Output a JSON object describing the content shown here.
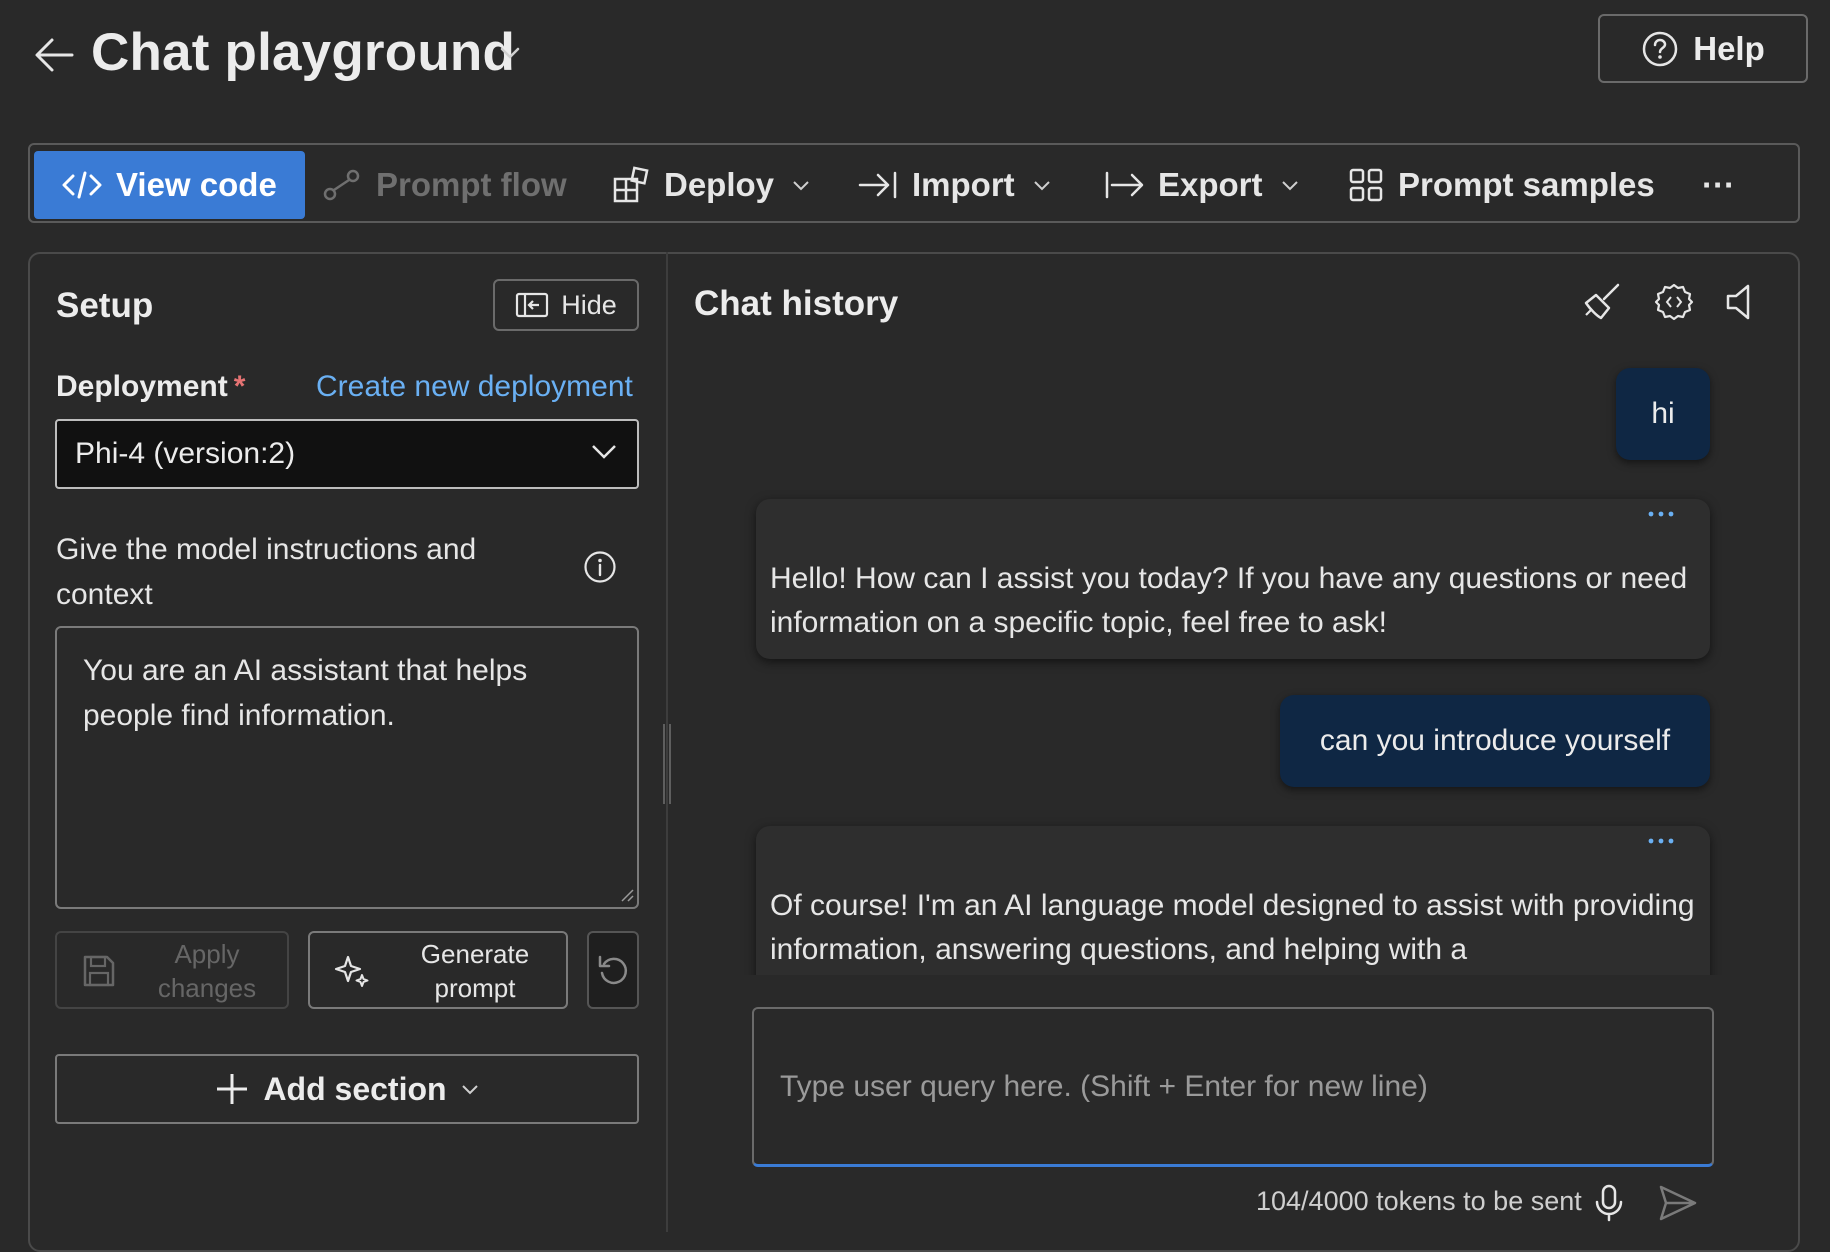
{
  "header": {
    "title": "Chat playground",
    "help_label": "Help"
  },
  "toolbar": {
    "view_code": "View code",
    "prompt_flow": "Prompt flow",
    "deploy": "Deploy",
    "import": "Import",
    "export": "Export",
    "prompt_samples": "Prompt samples",
    "more": "···"
  },
  "setup": {
    "title": "Setup",
    "hide_label": "Hide",
    "deployment_label": "Deployment",
    "required_mark": "*",
    "create_link": "Create new deployment",
    "deployment_value": "Phi-4 (version:2)",
    "instructions_label": "Give the model instructions and context",
    "system_message": "You are an AI assistant that helps people find information.",
    "apply_label": "Apply changes",
    "generate_label": "Generate prompt",
    "add_section_label": "Add section"
  },
  "chat": {
    "title": "Chat history",
    "messages": [
      {
        "role": "user",
        "text": "hi"
      },
      {
        "role": "assistant",
        "text": "Hello! How can I assist you today? If you have any questions or need information on a specific topic, feel free to ask!"
      },
      {
        "role": "user",
        "text": "can you introduce yourself"
      },
      {
        "role": "assistant",
        "text": "Of course! I'm an AI language model designed to assist with providing information, answering questions, and helping with a"
      }
    ],
    "input_placeholder": "Type user query here. (Shift + Enter for new line)",
    "token_status": "104/4000 tokens to be sent"
  },
  "colors": {
    "background": "#292929",
    "accent": "#3a7bd5",
    "link": "#6ab0f3",
    "user_bubble": "#0f2744",
    "required": "#e57373"
  }
}
